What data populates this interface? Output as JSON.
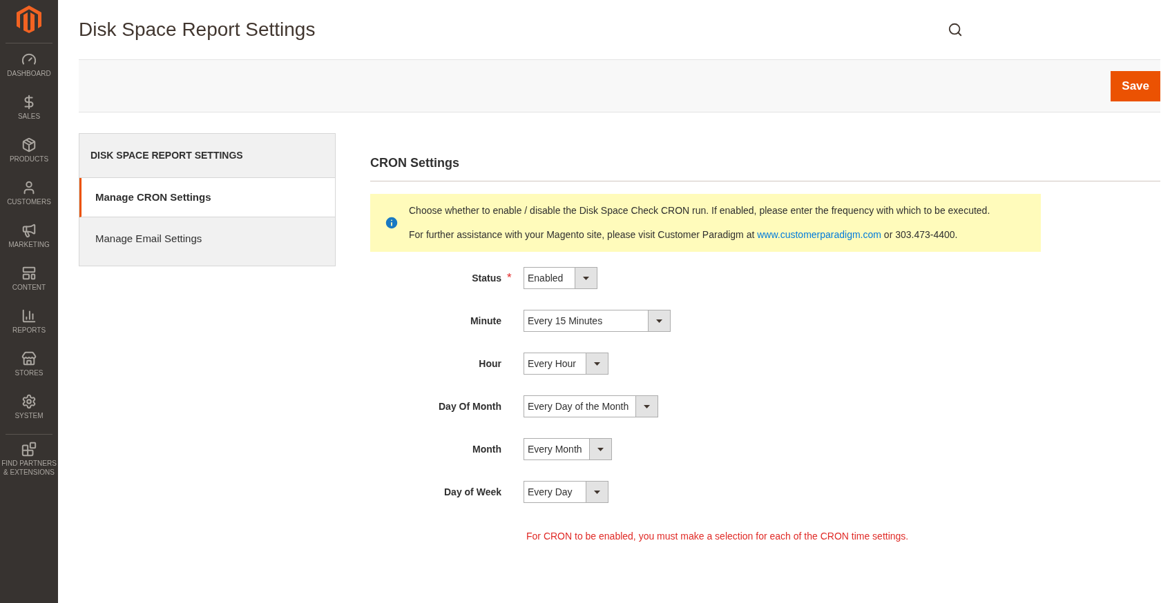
{
  "nav": [
    {
      "label": "DASHBOARD"
    },
    {
      "label": "SALES"
    },
    {
      "label": "PRODUCTS"
    },
    {
      "label": "CUSTOMERS"
    },
    {
      "label": "MARKETING"
    },
    {
      "label": "CONTENT"
    },
    {
      "label": "REPORTS"
    },
    {
      "label": "STORES"
    },
    {
      "label": "SYSTEM"
    },
    {
      "label": "FIND PARTNERS & EXTENSIONS"
    }
  ],
  "page_title": "Disk Space Report Settings",
  "save_button": "Save",
  "side_panel": {
    "title": "DISK SPACE REPORT SETTINGS",
    "items": [
      {
        "label": "Manage CRON Settings",
        "selected": true
      },
      {
        "label": "Manage Email Settings",
        "selected": false
      }
    ]
  },
  "section_title": "CRON Settings",
  "notice": {
    "line_1": "Choose whether to enable / disable the Disk Space Check CRON run. If enabled, please enter the frequency with which to be executed.",
    "line_2_before": "For further assistance with your Magento site, please visit Customer Paradigm at",
    "line_2_link": "www.customerparadigm.com",
    "line_2_after": "or 303.473-4400."
  },
  "fields": [
    {
      "label": "Status",
      "value": "Enabled",
      "mark": "*"
    },
    {
      "label": "Minute",
      "value": "Every 15 Minutes"
    },
    {
      "label": "Hour",
      "value": "Every Hour"
    },
    {
      "label": "Day Of Month",
      "value": "Every Day of the Month"
    },
    {
      "label": "Month",
      "value": "Every Month"
    },
    {
      "label": "Day of Week",
      "value": "Every Day"
    }
  ],
  "warning": "For CRON to be enabled, you must make a selection for each of the CRON time settings."
}
